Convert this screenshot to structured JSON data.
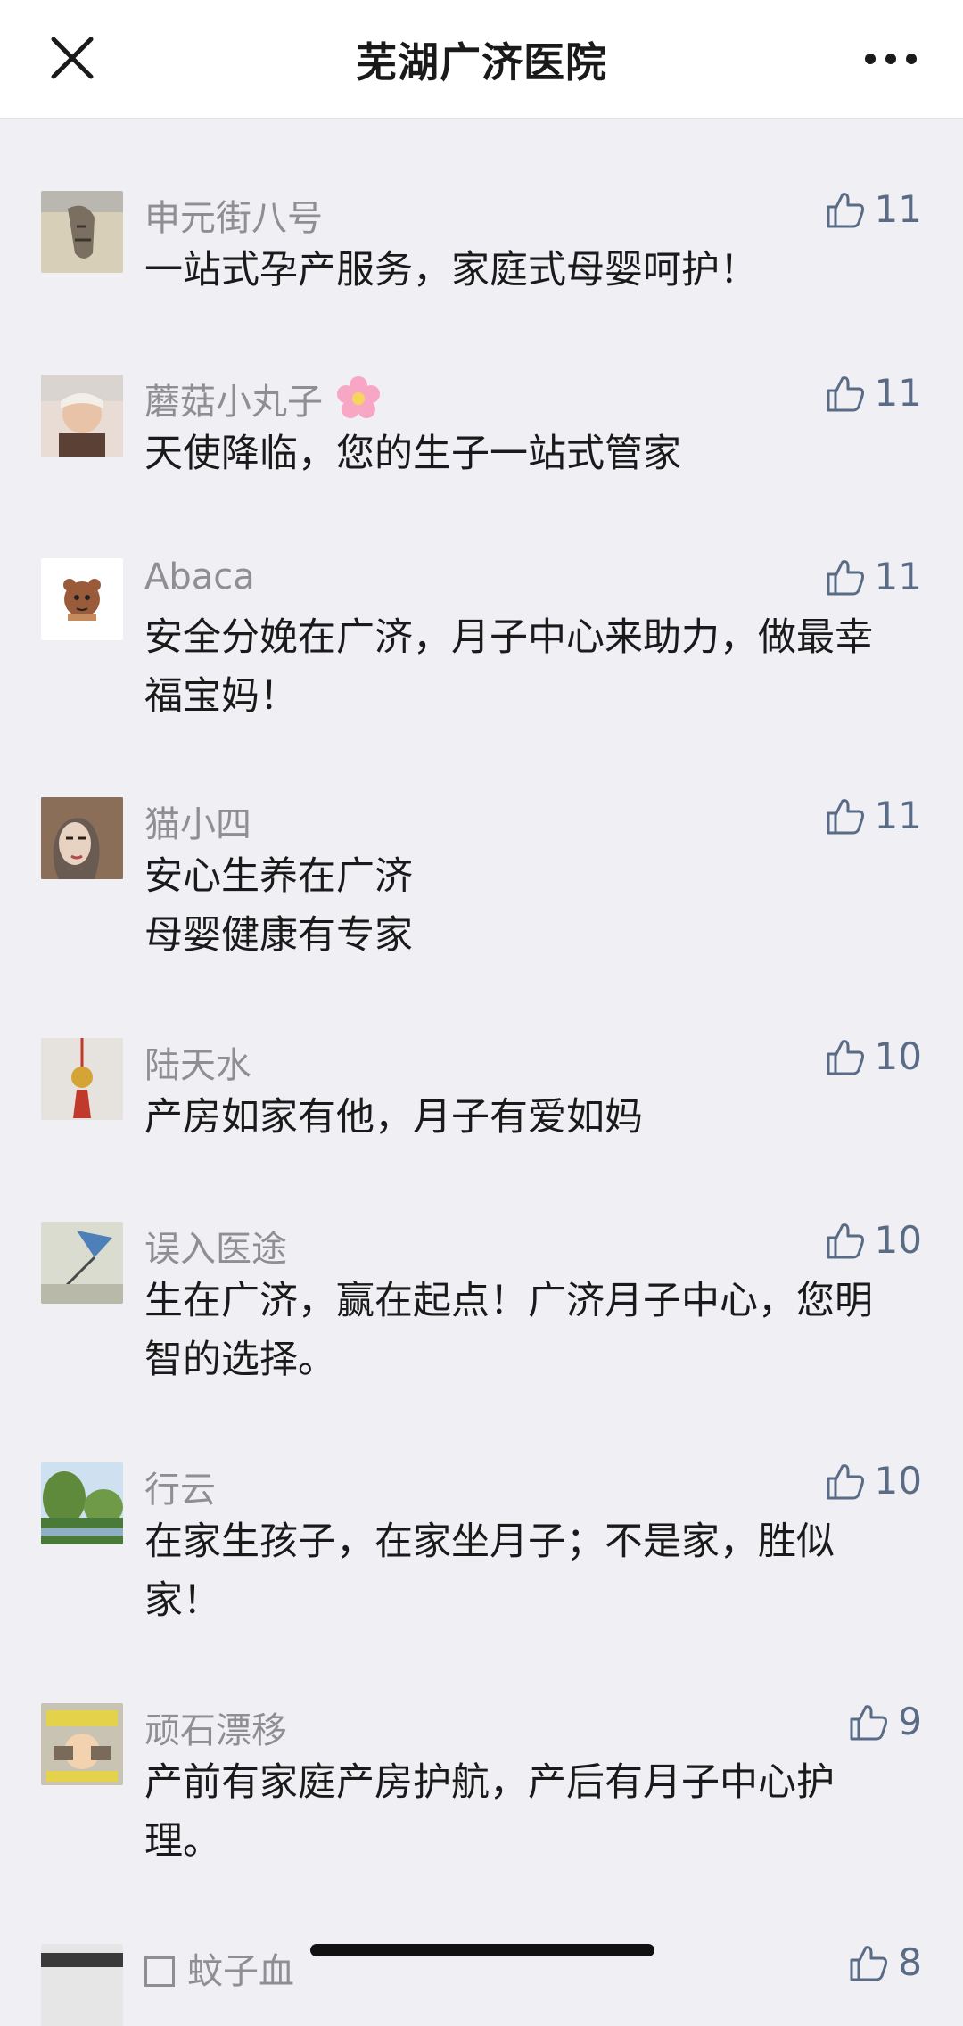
{
  "header": {
    "title": "芜湖广济医院"
  },
  "comments": [
    {
      "nickname": "申元街八号",
      "text": "一站式孕产服务，家庭式母婴呵护！",
      "likes": "11"
    },
    {
      "nickname": "蘑菇小丸子",
      "text": "天使降临，您的生子一站式管家",
      "likes": "11"
    },
    {
      "nickname": "Abaca",
      "text": "安全分娩在广济，月子中心来助力，做最幸福宝妈！",
      "likes": "11"
    },
    {
      "nickname": "猫小四",
      "text": "安心生养在广济\n母婴健康有专家",
      "likes": "11"
    },
    {
      "nickname": "陆天水",
      "text": "产房如家有他，月子有爱如妈",
      "likes": "10"
    },
    {
      "nickname": "误入医途",
      "text": "生在广济，赢在起点！广济月子中心，您明智的选择。",
      "likes": "10"
    },
    {
      "nickname": "行云",
      "text": "在家生孩子，在家坐月子；不是家，胜似家！",
      "likes": "10"
    },
    {
      "nickname": "顽石漂移",
      "text": "产前有家庭产房护航，产后有月子中心护理。",
      "likes": "9"
    },
    {
      "nickname": "蚊子血",
      "text": "",
      "likes": "8"
    }
  ],
  "colors": {
    "background": "#efeff4",
    "nickname": "#8e8e93",
    "like": "#5a6b86"
  }
}
